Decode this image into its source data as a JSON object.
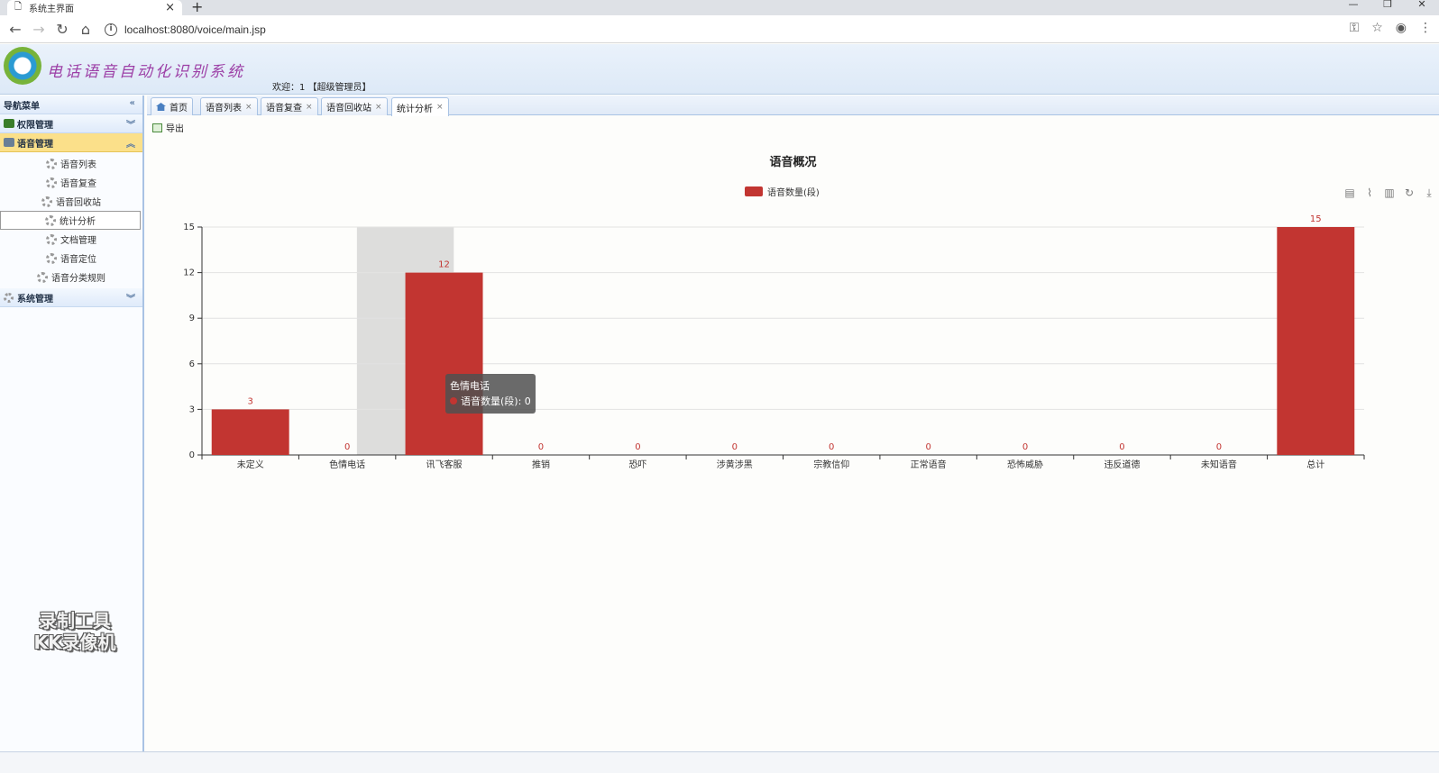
{
  "browser": {
    "tab_title": "系统主界面",
    "url": "localhost:8080/voice/main.jsp"
  },
  "app": {
    "title": "电话语音自动化识别系统",
    "welcome": "欢迎：1 【超级管理员】"
  },
  "sidebar": {
    "header": "导航菜单",
    "groups": [
      {
        "label": "权限管理",
        "expanded": false
      },
      {
        "label": "语音管理",
        "expanded": true,
        "items": [
          {
            "label": "语音列表"
          },
          {
            "label": "语音复查"
          },
          {
            "label": "语音回收站"
          },
          {
            "label": "统计分析"
          },
          {
            "label": "文档管理"
          },
          {
            "label": "语音定位"
          },
          {
            "label": "语音分类规则"
          }
        ]
      },
      {
        "label": "系统管理",
        "expanded": false
      }
    ],
    "watermark_line1": "录制工具",
    "watermark_line2": "KK录像机"
  },
  "tabs": [
    {
      "label": "首页"
    },
    {
      "label": "语音列表"
    },
    {
      "label": "语音复查"
    },
    {
      "label": "语音回收站"
    },
    {
      "label": "统计分析"
    }
  ],
  "toolbar": {
    "export_label": "导出"
  },
  "tooltip": {
    "title": "色情电话",
    "line": "语音数量(段): 0"
  },
  "colors": {
    "bar": "#c23531",
    "header_bg": "#dde9f7",
    "active_menu": "#fbe08a"
  },
  "chart_data": {
    "type": "bar",
    "title": "语音概况",
    "categories": [
      "未定义",
      "色情电话",
      "讯飞客服",
      "推销",
      "恐吓",
      "涉黄涉黑",
      "宗教信仰",
      "正常语音",
      "恐怖威胁",
      "违反道德",
      "未知语音",
      "总计"
    ],
    "series": [
      {
        "name": "语音数量(段)",
        "values": [
          3,
          0,
          12,
          0,
          0,
          0,
          0,
          0,
          0,
          0,
          0,
          15
        ]
      }
    ],
    "ylim": [
      0,
      15
    ],
    "yticks": [
      0,
      3,
      6,
      9,
      12,
      15
    ],
    "legend_position": "top-center",
    "grid": true,
    "highlighted_category": "色情电话"
  }
}
